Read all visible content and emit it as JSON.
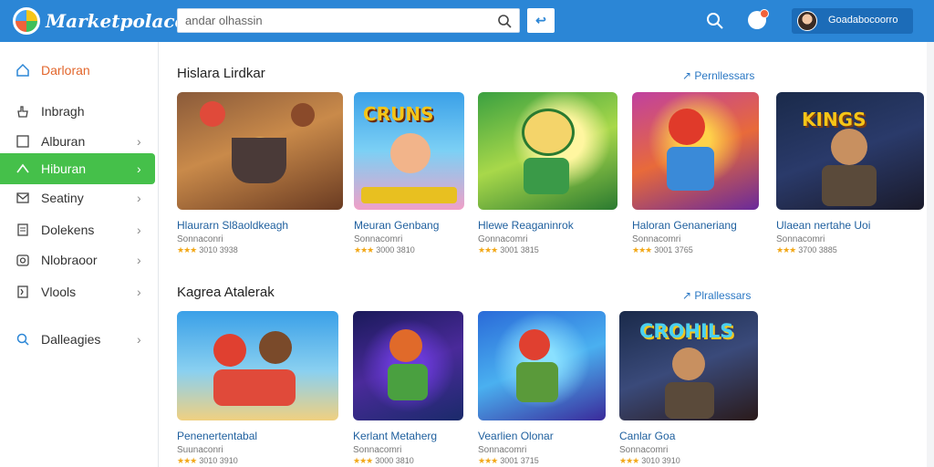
{
  "header": {
    "logo_text": "Marketpolace",
    "search_placeholder": "andar olhassin",
    "search_button_label": "↩",
    "user_name": "Goadabocoorro"
  },
  "sidebar": {
    "items": [
      {
        "label": "Darloran",
        "icon": "home-icon",
        "chevron": false
      },
      {
        "label": "Inbragh",
        "icon": "hand-icon",
        "chevron": false
      },
      {
        "label": "Alburan",
        "icon": "square-icon",
        "chevron": true
      },
      {
        "label": "Hiburan",
        "icon": "arrow-icon",
        "chevron": true
      },
      {
        "label": "Seatiny",
        "icon": "mail-icon",
        "chevron": true
      },
      {
        "label": "Dolekens",
        "icon": "doc-icon",
        "chevron": true
      },
      {
        "label": "Nlobraoor",
        "icon": "camera-icon",
        "chevron": true
      },
      {
        "label": "Vlools",
        "icon": "flag-icon",
        "chevron": true
      },
      {
        "label": "Dalleagies",
        "icon": "search-icon",
        "chevron": true
      }
    ]
  },
  "sections": [
    {
      "title": "Hislara Lirdkar",
      "see_all": "↗ Pernllessars",
      "cards": [
        {
          "title": "Hlaurarn Sl8aoldkeagh",
          "sub": "Sonnaconri",
          "rating": "3010 3938",
          "art_text": ""
        },
        {
          "title": "Meuran Genbang",
          "sub": "Sonnacomri",
          "rating": "3000 3810",
          "art_text": "CRUNS"
        },
        {
          "title": "Hlewe Reaganinrok",
          "sub": "Gonnacomri",
          "rating": "3001 3815",
          "art_text": ""
        },
        {
          "title": "Haloran Genaneriang",
          "sub": "Sonnacomri",
          "rating": "3001 3765",
          "art_text": ""
        },
        {
          "title": "Ulaean nertahe Uoi",
          "sub": "Sonnacomri",
          "rating": "3700 3885",
          "art_text": "KINGS"
        }
      ]
    },
    {
      "title": "Kagrea Atalerak",
      "see_all": "↗ Plrallessars",
      "cards": [
        {
          "title": "Penenertentabal",
          "sub": "Suunaconri",
          "rating": "3010 3910",
          "art_text": ""
        },
        {
          "title": "Kerlant Metaherg",
          "sub": "Sonnacomri",
          "rating": "3000 3810",
          "art_text": ""
        },
        {
          "title": "Vearlien Olonar",
          "sub": "Sonnacomri",
          "rating": "3001 3715",
          "art_text": ""
        },
        {
          "title": "Canlar Goa",
          "sub": "Sonnacomri",
          "rating": "3010 3910",
          "art_text": "CROHILS"
        }
      ]
    }
  ],
  "colors": {
    "header": "#2b86d6",
    "active": "#45c04a",
    "link": "#1e5f9e",
    "star": "#f2a818"
  }
}
